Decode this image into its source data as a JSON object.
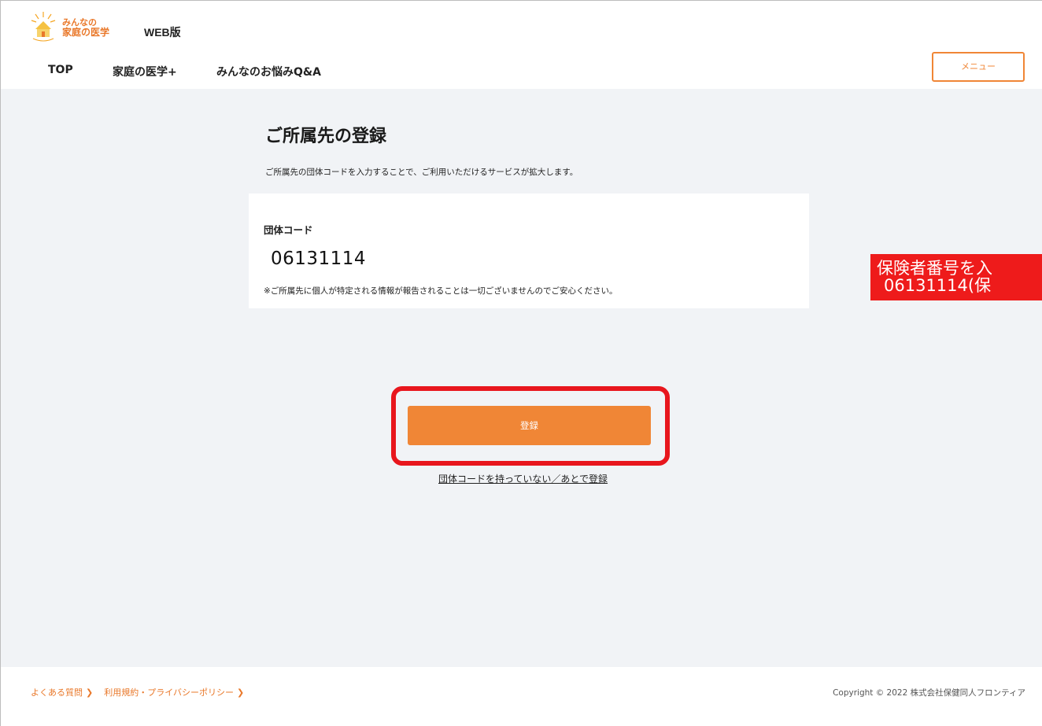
{
  "header": {
    "logo_line1": "みんなの",
    "logo_line2": "家庭の医学",
    "web_label": "WEB版",
    "nav": [
      "TOP",
      "家庭の医学+",
      "みんなのお悩みQ&A"
    ],
    "menu_label": "メニュー"
  },
  "main": {
    "title": "ご所属先の登録",
    "description": "ご所属先の団体コードを入力することで、ご利用いただけるサービスが拡大します。",
    "card": {
      "label": "団体コード",
      "code_value": "06131114",
      "note": "※ご所属先に個人が特定される情報が報告されることは一切ございませんのでご安心ください。"
    },
    "register_button": "登録",
    "later_link": "団体コードを持っていない／あとで登録"
  },
  "annotation": {
    "line1": "保険者番号を入",
    "line2": "06131114(保"
  },
  "footer": {
    "faq": "よくある質問",
    "terms": "利用規約・プライバシーポリシー",
    "chevron": "❯",
    "copyright": "Copyright © 2022 株式会社保健同人フロンティア"
  },
  "colors": {
    "accent": "#f08636",
    "highlight_red": "#e8161d",
    "background": "#f1f3f6"
  }
}
